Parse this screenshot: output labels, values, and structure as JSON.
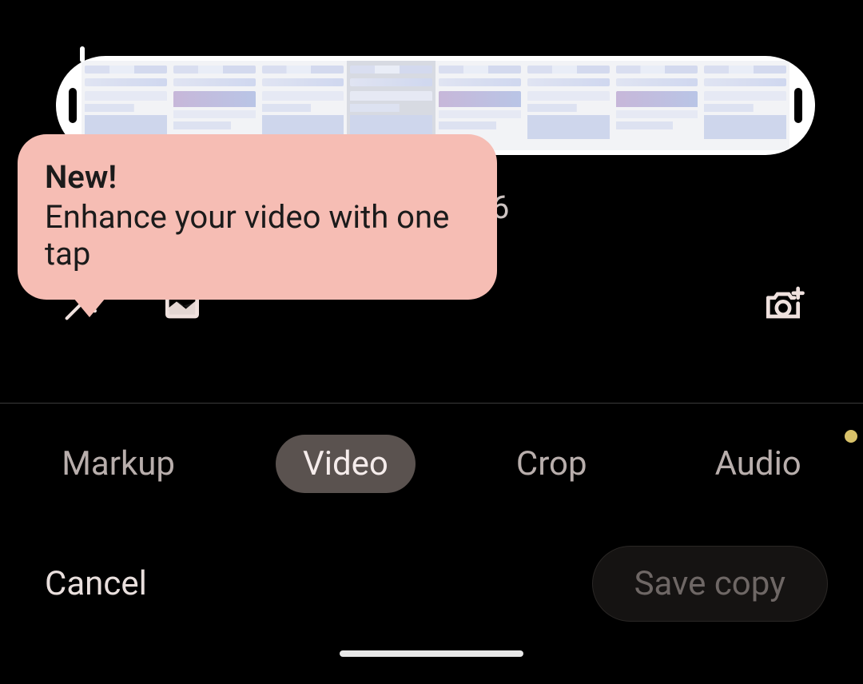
{
  "tooltip": {
    "title": "New!",
    "body": "Enhance your video with one tap"
  },
  "duration_partial": "6",
  "tools": {
    "enhance": "magic-wand-icon",
    "stabilize": "frame-icon",
    "export_frame": "camera-plus-icon"
  },
  "tabs": {
    "items": [
      {
        "label": "Markup",
        "active": false,
        "has_dot": false
      },
      {
        "label": "Video",
        "active": true,
        "has_dot": false
      },
      {
        "label": "Crop",
        "active": false,
        "has_dot": false
      },
      {
        "label": "Audio",
        "active": false,
        "has_dot": true
      }
    ]
  },
  "actions": {
    "cancel": "Cancel",
    "save": "Save copy"
  }
}
